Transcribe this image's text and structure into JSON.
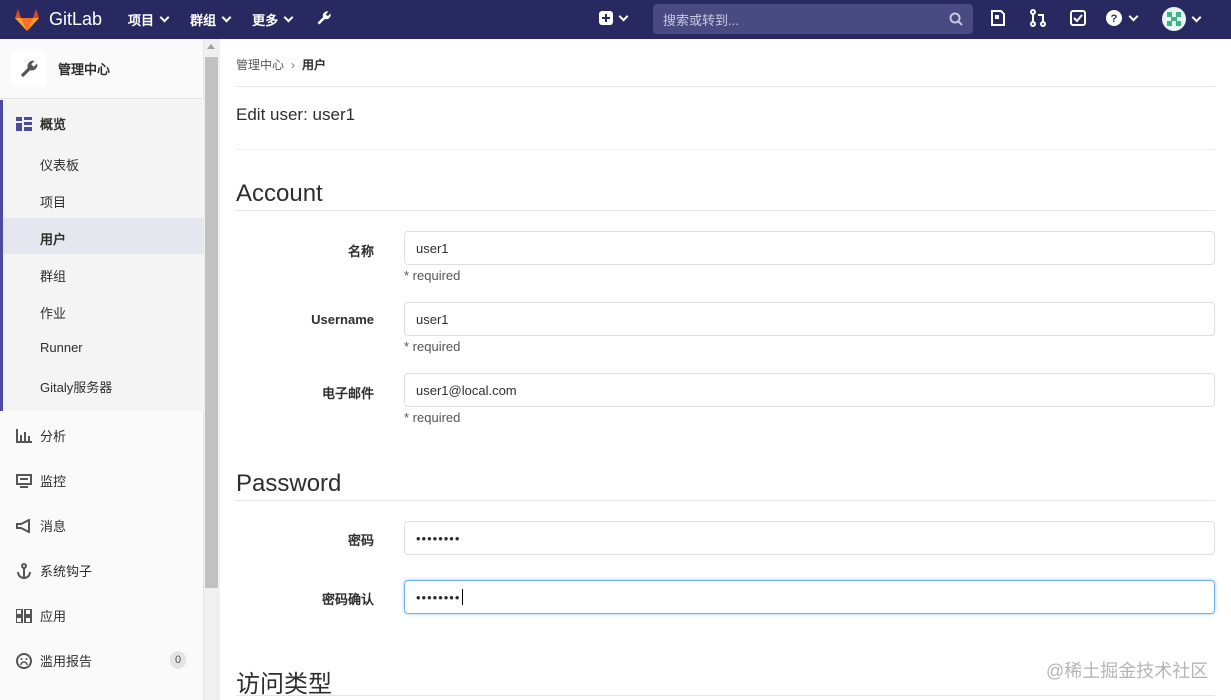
{
  "navbar": {
    "brand": "GitLab",
    "menus": [
      "项目",
      "群组",
      "更多"
    ],
    "search_placeholder": "搜索或转到..."
  },
  "sidebar": {
    "admin_title": "管理中心",
    "overview": "概览",
    "sub_items": [
      "仪表板",
      "项目",
      "用户",
      "群组",
      "作业",
      "Runner",
      "Gitaly服务器"
    ],
    "sections": [
      "分析",
      "监控",
      "消息",
      "系统钩子",
      "应用",
      "滥用报告"
    ],
    "abuse_count": "0"
  },
  "breadcrumb": {
    "parent": "管理中心",
    "current": "用户"
  },
  "page_title": "Edit user: user1",
  "account": {
    "title": "Account",
    "name_label": "名称",
    "name_value": "user1",
    "username_label": "Username",
    "username_value": "user1",
    "email_label": "电子邮件",
    "email_value": "user1@local.com",
    "required": "* required"
  },
  "password": {
    "title": "Password",
    "pw_label": "密码",
    "pw_value": "••••••••",
    "confirm_label": "密码确认",
    "confirm_value": "••••••••"
  },
  "access": {
    "title": "访问类型"
  },
  "watermark": "@稀土掘金技术社区",
  "colors": {
    "navbar": "#292961",
    "active_border": "#4b4ba3",
    "focus": "#73afea"
  }
}
